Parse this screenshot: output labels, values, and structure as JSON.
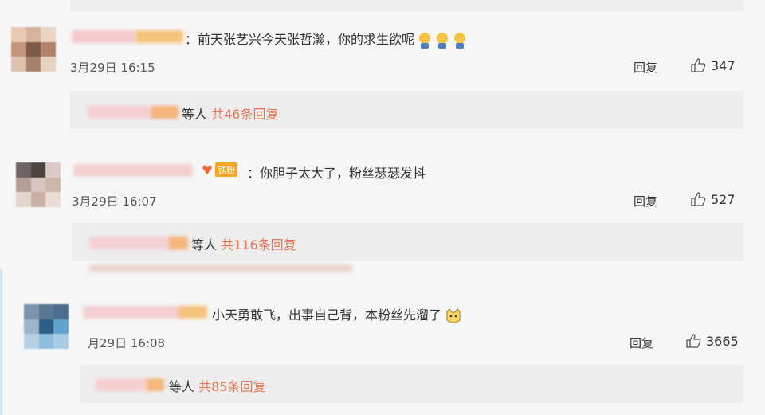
{
  "comments": [
    {
      "text": "：前天张艺兴今天张哲瀚，你的求生欲呢",
      "time": "3月29日 16:15",
      "reply_label": "回复",
      "likes": "347",
      "sub": {
        "prefix": "等人 ",
        "count": "共46条回复"
      },
      "emoji": "sweat-emoji"
    },
    {
      "text": "：你胆子太大了，粉丝瑟瑟发抖",
      "badge": "铁粉",
      "time": "3月29日 16:07",
      "reply_label": "回复",
      "likes": "527",
      "sub": {
        "prefix": "等人 ",
        "count": "共116条回复"
      }
    },
    {
      "text": "小天勇敢飞，出事自己背，本粉丝先溜了",
      "time": "月29日 16:08",
      "reply_label": "回复",
      "likes": "3665",
      "sub": {
        "prefix": "等人 ",
        "count": "共85条回复"
      },
      "emoji": "cat-emoji"
    }
  ],
  "colors": {
    "accent": "#eb7350",
    "badge": "#f6a623"
  }
}
